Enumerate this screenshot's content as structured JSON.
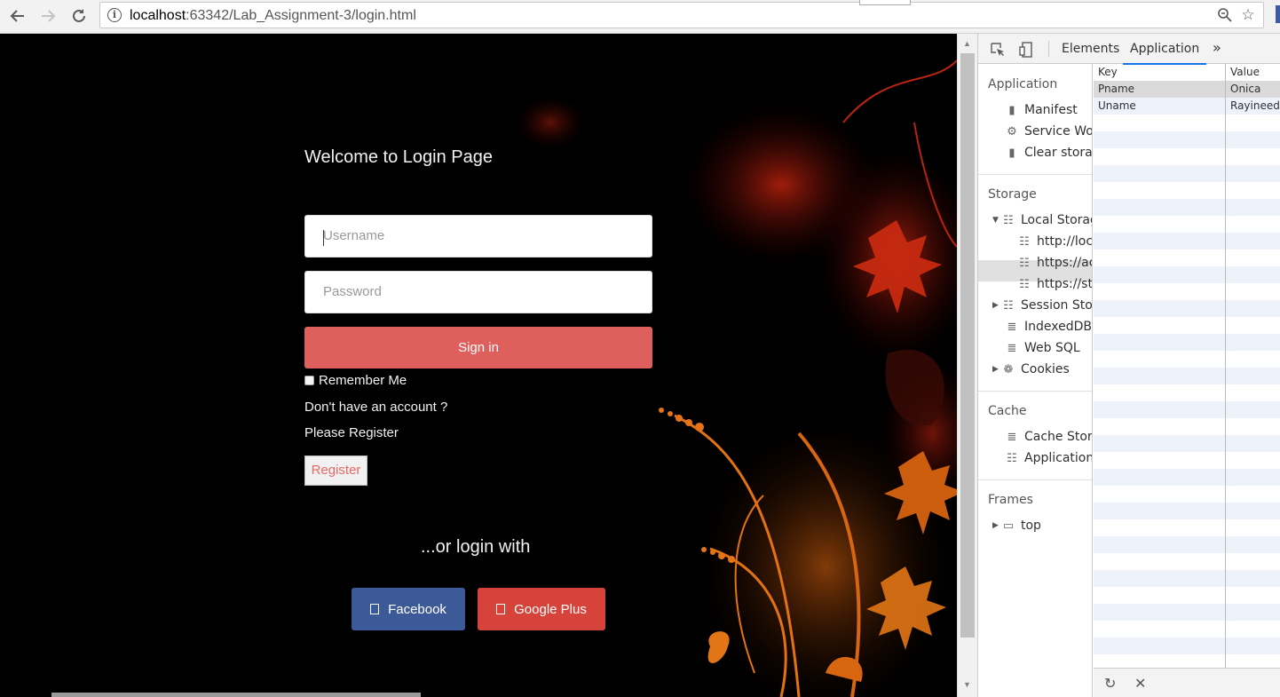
{
  "browser": {
    "url_host": "localhost",
    "url_path": ":63342/Lab_Assignment-3/login.html",
    "back_icon": "arrow-left-icon",
    "forward_icon": "arrow-right-icon",
    "reload_icon": "reload-icon",
    "zoom_icon": "zoom-icon",
    "bookmark_icon": "star-icon"
  },
  "login": {
    "title": "Welcome to Login Page",
    "username_placeholder": "Username",
    "password_placeholder": "Password",
    "signin_label": "Sign in",
    "remember_label": "Remember Me",
    "no_account_text": "Don't have an account ?",
    "please_register_text": "Please Register",
    "register_label": "Register",
    "or_login_text": "...or login with",
    "facebook_label": "Facebook",
    "google_label": "Google Plus",
    "colors": {
      "signin": "#df5f5c",
      "facebook": "#3c5998",
      "google": "#d6433a"
    }
  },
  "devtools": {
    "tabs": [
      "Elements",
      "Application"
    ],
    "active_tab": "Application",
    "more_label": "»",
    "sidebar": {
      "application_header": "Application",
      "application_items": [
        "Manifest",
        "Service Wor",
        "Clear storag"
      ],
      "storage_header": "Storage",
      "local_storage": "Local Storag",
      "local_origins": [
        "http://loca",
        "https://ac",
        "https://sta"
      ],
      "session_storage": "Session Stor",
      "indexeddb": "IndexedDB",
      "websql": "Web SQL",
      "cookies": "Cookies",
      "cache_header": "Cache",
      "cache_items": [
        "Cache Stora",
        "Application"
      ],
      "frames_header": "Frames",
      "frames_top": "top"
    },
    "table": {
      "headers": [
        "Key",
        "Value"
      ],
      "rows": [
        {
          "key": "Pname",
          "value": "Onica"
        },
        {
          "key": "Uname",
          "value": "Rayineedi"
        }
      ]
    }
  }
}
